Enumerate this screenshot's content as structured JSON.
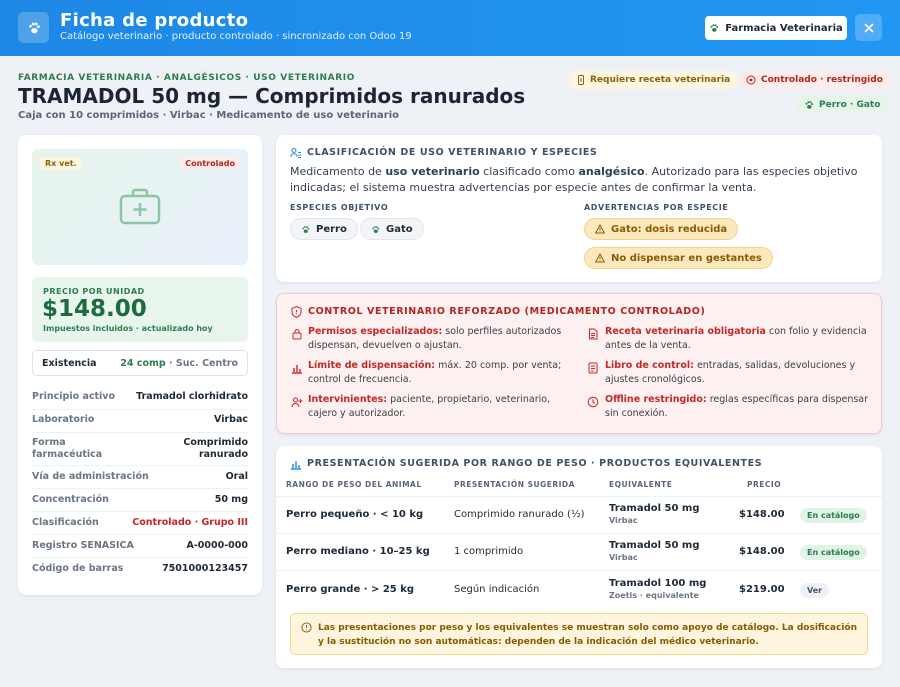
{
  "header": {
    "title": "Ficha de producto",
    "subtitle": "Catálogo veterinario · producto controlado · sincronizado con Odoo 19",
    "pharmacy_button": "Farmacia Veterinaria",
    "accent_color": "#1e88e5"
  },
  "product": {
    "eyebrow": "FARMACIA VETERINARIA · ANALGÉSICOS · USO VETERINARIO",
    "name": "TRAMADOL 50 mg — Comprimidos ranurados",
    "subtitle": "Caja con 10 comprimidos · Virbac · Medicamento de uso veterinario",
    "chips": {
      "prescription": "Requiere receta veterinaria",
      "controlled": "Controlado · restringido",
      "species": "Perro · Gato"
    }
  },
  "left": {
    "image_tag_rx": "Rx vet.",
    "image_tag_controlled": "Controlado",
    "price_label": "PRECIO POR UNIDAD",
    "price": "$148.00",
    "price_note": "Impuestos incluidos · actualizado hoy",
    "stock_label": "Existencia",
    "stock_qty": "24 comp",
    "stock_branch": " · Suc. Centro",
    "specs": [
      {
        "label": "Principio activo",
        "value": "Tramadol clorhidrato"
      },
      {
        "label": "Laboratorio",
        "value": "Virbac"
      },
      {
        "label": "Forma farmacéutica",
        "value": "Comprimido ranurado"
      },
      {
        "label": "Vía de administración",
        "value": "Oral"
      },
      {
        "label": "Concentración",
        "value": "50 mg"
      },
      {
        "label": "Clasificación",
        "value": "Controlado · Grupo III"
      },
      {
        "label": "Registro SENASICA",
        "value": "A-0000-000"
      },
      {
        "label": "Código de barras",
        "value": "7501000123457"
      }
    ]
  },
  "classification": {
    "title": "CLASIFICACIÓN DE USO VETERINARIO Y ESPECIES",
    "text_1": "Medicamento de ",
    "text_2": "uso veterinario",
    "text_3": " clasificado como ",
    "text_4": "analgésico",
    "text_5": ". Autorizado para las especies objetivo indicadas; el sistema muestra advertencias por especie antes de confirmar la venta.",
    "species_heading": "ESPECIES OBJETIVO",
    "species": [
      "Perro",
      "Gato"
    ],
    "warnings_heading": "ADVERTENCIAS POR ESPECIE",
    "warnings": [
      "Gato: dosis reducida",
      "No dispensar en gestantes"
    ]
  },
  "control": {
    "title": "CONTROL VETERINARIO REFORZADO (MEDICAMENTO CONTROLADO)",
    "items": [
      {
        "label": "Permisos especializados:",
        "text": " solo perfiles autorizados dispensan, devuelven o ajustan."
      },
      {
        "label": "Receta veterinaria obligatoria",
        "text": " con folio y evidencia antes de la venta."
      },
      {
        "label": "Límite de dispensación:",
        "text": " máx. 20 comp. por venta; control de frecuencia."
      },
      {
        "label": "Libro de control:",
        "text": " entradas, salidas, devoluciones y ajustes cronológicos."
      },
      {
        "label": "Intervinientes:",
        "text": " paciente, propietario, veterinario, cajero y autorizador."
      },
      {
        "label": "Offline restringido:",
        "text": " reglas específicas para dispensar sin conexión."
      }
    ]
  },
  "presentation": {
    "title": "PRESENTACIÓN SUGERIDA POR RANGO DE PESO · PRODUCTOS EQUIVALENTES",
    "columns": [
      "RANGO DE PESO DEL ANIMAL",
      "PRESENTACIÓN SUGERIDA",
      "EQUIVALENTE",
      "PRECIO"
    ],
    "rows": [
      {
        "range": "Perro pequeño · < 10 kg",
        "suggested": "Comprimido ranurado (½)",
        "eq_name": "Tramadol 50 mg",
        "eq_sub": "Virbac",
        "price": "$148.00",
        "status": "En catálogo"
      },
      {
        "range": "Perro mediano · 10–25 kg",
        "suggested": "1 comprimido",
        "eq_name": "Tramadol 50 mg",
        "eq_sub": "Virbac",
        "price": "$148.00",
        "status": "En catálogo"
      },
      {
        "range": "Perro grande · > 25 kg",
        "suggested": "Según indicación",
        "eq_name": "Tramadol 100 mg",
        "eq_sub": "Zoetis · equivalente",
        "price": "$219.00",
        "status": "Ver"
      }
    ],
    "note": "Las presentaciones por peso y los equivalentes se muestran solo como apoyo de catálogo. La dosificación y la sustitución no son automáticas: dependen de la indicación del médico veterinario."
  }
}
